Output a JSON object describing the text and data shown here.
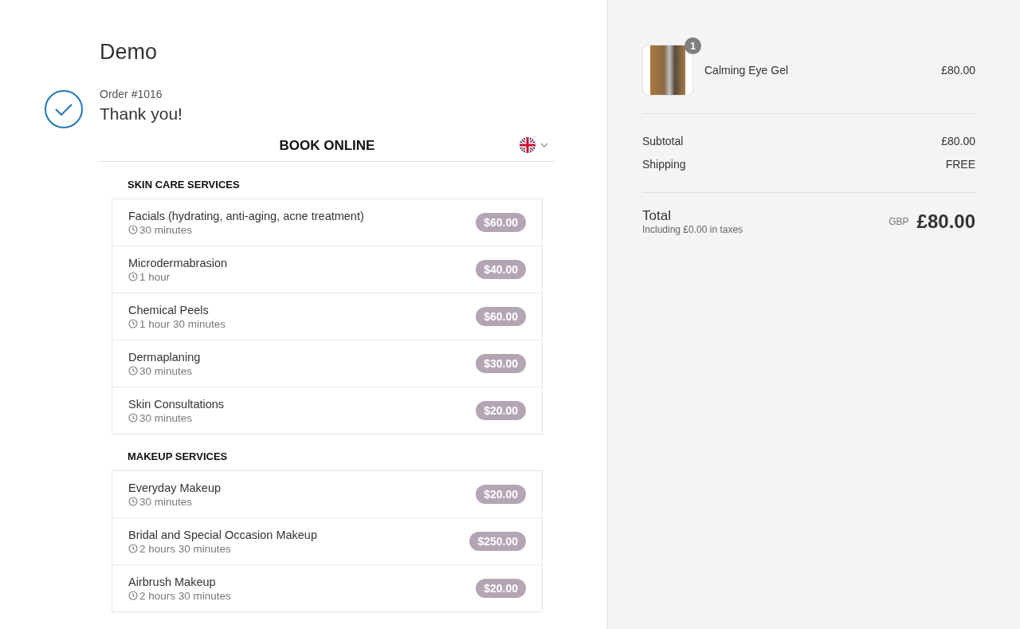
{
  "shop_name": "Demo",
  "order": {
    "number": "Order #1016",
    "message": "Thank you!"
  },
  "booking": {
    "title": "BOOK ONLINE",
    "categories": [
      {
        "title": "SKIN CARE SERVICES",
        "services": [
          {
            "name": "Facials (hydrating, anti-aging, acne treatment)",
            "duration": "30 minutes",
            "price": "$60.00"
          },
          {
            "name": "Microdermabrasion",
            "duration": "1 hour",
            "price": "$40.00"
          },
          {
            "name": "Chemical Peels",
            "duration": "1 hour 30 minutes",
            "price": "$60.00"
          },
          {
            "name": "Dermaplaning",
            "duration": "30 minutes",
            "price": "$30.00"
          },
          {
            "name": "Skin Consultations",
            "duration": "30 minutes",
            "price": "$20.00"
          }
        ]
      },
      {
        "title": "MAKEUP SERVICES",
        "services": [
          {
            "name": "Everyday Makeup",
            "duration": "30 minutes",
            "price": "$20.00"
          },
          {
            "name": "Bridal and Special Occasion Makeup",
            "duration": "2 hours 30 minutes",
            "price": "$250.00"
          },
          {
            "name": "Airbrush Makeup",
            "duration": "2 hours 30 minutes",
            "price": "$20.00"
          }
        ]
      }
    ]
  },
  "summary": {
    "items": [
      {
        "quantity": "1",
        "name": "Calming Eye Gel",
        "price": "£80.00"
      }
    ],
    "lines": [
      {
        "label": "Subtotal",
        "value": "£80.00"
      },
      {
        "label": "Shipping",
        "value": "FREE"
      }
    ],
    "total": {
      "label": "Total",
      "taxes": "Including £0.00 in taxes",
      "currency": "GBP",
      "amount": "£80.00"
    }
  }
}
